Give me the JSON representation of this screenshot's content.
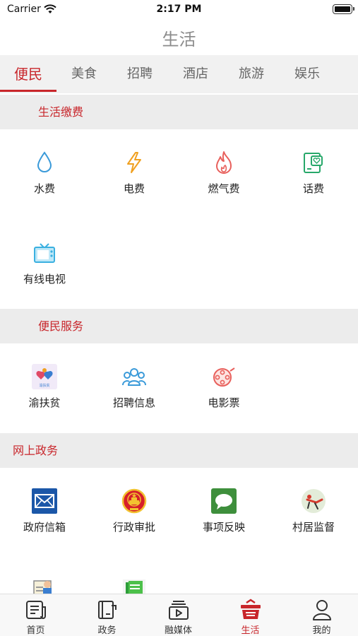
{
  "status": {
    "carrier": "Carrier",
    "time": "2:17 PM"
  },
  "nav": {
    "title": "生活"
  },
  "tabs": [
    "便民",
    "美食",
    "招聘",
    "酒店",
    "旅游",
    "娱乐"
  ],
  "sections": {
    "payment": {
      "title": "生活缴费",
      "items": [
        "水费",
        "电费",
        "燃气费",
        "话费",
        "有线电视"
      ]
    },
    "service": {
      "title": "便民服务",
      "items": [
        "渝扶贫",
        "招聘信息",
        "电影票"
      ],
      "badge_text": "渝扶贫"
    },
    "gov": {
      "title": "网上政务",
      "items": [
        "政府信箱",
        "行政审批",
        "事项反映",
        "村居监督"
      ]
    }
  },
  "tabbar": [
    "首页",
    "政务",
    "融媒体",
    "生活",
    "我的"
  ],
  "colors": {
    "accent": "#c8262b",
    "section_bg": "#ececec",
    "tabs_bg": "#f1f1f1"
  }
}
